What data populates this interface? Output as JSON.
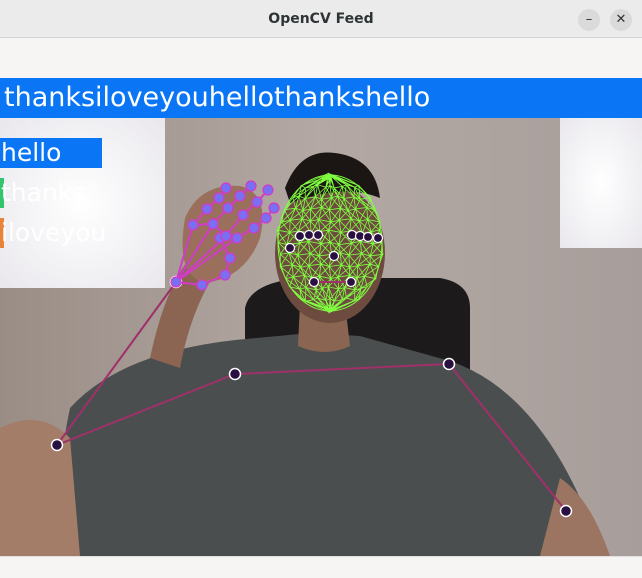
{
  "window": {
    "title": "OpenCV Feed",
    "minimize_glyph": "–",
    "close_glyph": "✕"
  },
  "overlay": {
    "sentence": "thanksiloveyouhellothankshello",
    "sentence_bar_color": "#0b76f5",
    "predictions": [
      {
        "label": "hello",
        "color": "#0b76f5",
        "probability": 0.16
      },
      {
        "label": "thanks",
        "color": "#35c46e",
        "probability": 0.004
      },
      {
        "label": "iloveyou",
        "color": "#e8843a",
        "probability": 0.004
      }
    ]
  },
  "landmark_colors": {
    "face_mesh": "#80ff40",
    "pose_lines": "#a0306a",
    "hand_lines": "#d23ac8",
    "hand_points": "#7a6ff0",
    "joint_outline": "#ffffff",
    "joint_fill": "#2a1040"
  }
}
